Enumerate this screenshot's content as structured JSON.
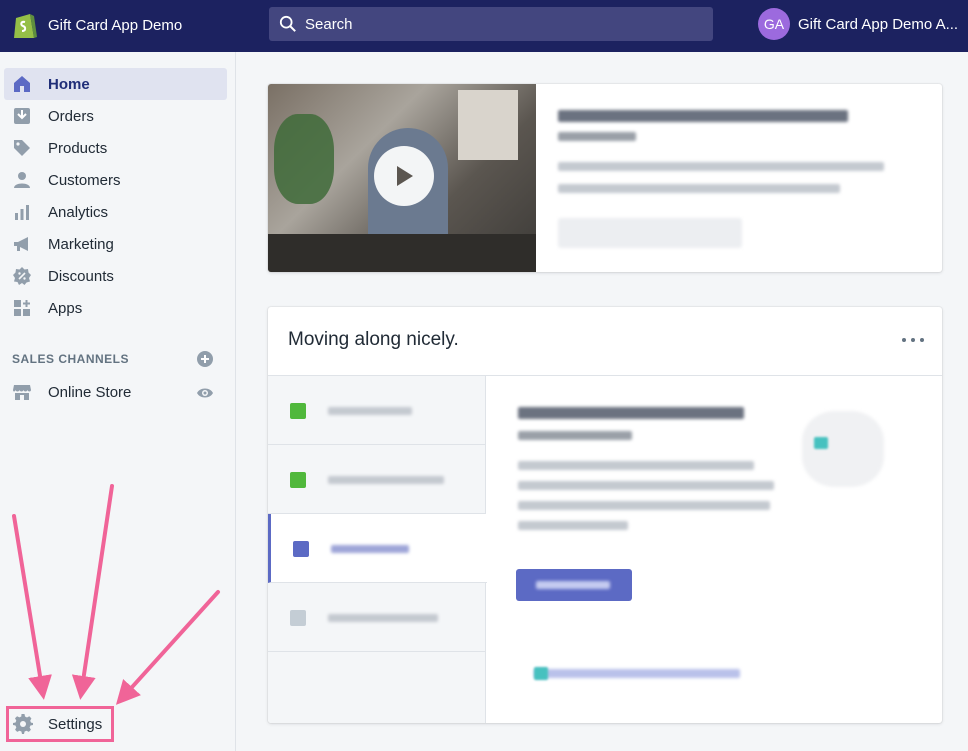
{
  "topbar": {
    "store_name": "Gift Card App Demo",
    "search_placeholder": "Search",
    "avatar_initials": "GA",
    "account_name": "Gift Card App Demo A..."
  },
  "sidebar": {
    "items": [
      {
        "label": "Home",
        "icon": "home-icon",
        "active": true
      },
      {
        "label": "Orders",
        "icon": "orders-icon"
      },
      {
        "label": "Products",
        "icon": "tag-icon"
      },
      {
        "label": "Customers",
        "icon": "person-icon"
      },
      {
        "label": "Analytics",
        "icon": "bar-chart-icon"
      },
      {
        "label": "Marketing",
        "icon": "megaphone-icon"
      },
      {
        "label": "Discounts",
        "icon": "discount-icon"
      },
      {
        "label": "Apps",
        "icon": "apps-icon"
      }
    ],
    "sales_channels_title": "SALES CHANNELS",
    "online_store_label": "Online Store",
    "settings_label": "Settings"
  },
  "progress": {
    "title": "Moving along nicely."
  },
  "colors": {
    "topbar": "#1c2260",
    "accent": "#5c6ac4",
    "highlight": "#f06498"
  }
}
